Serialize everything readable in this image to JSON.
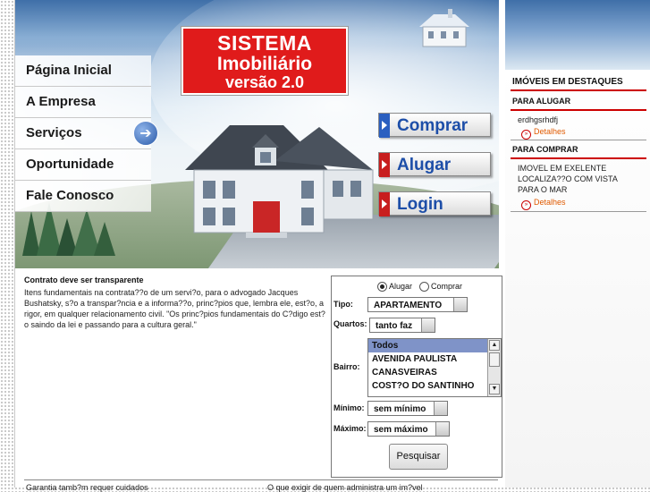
{
  "nav": {
    "items": [
      "Página Inicial",
      "A Empresa",
      "Serviços",
      "Oportunidade",
      "Fale Conosco"
    ]
  },
  "logo": {
    "line1": "SISTEMA",
    "line2": "Imobiliário",
    "line3": "versão 2.0"
  },
  "actions": {
    "comprar": "Comprar",
    "alugar": "Alugar",
    "login": "Login"
  },
  "sidebar": {
    "title": "IMÓVEIS EM DESTAQUES",
    "alugar_header": "PARA ALUGAR",
    "alugar_item": "erdhgsrhdfj",
    "detalhes1": "Detalhes",
    "comprar_header": "PARA COMPRAR",
    "comprar_item_l1": "IMOVEL EM EXELENTE",
    "comprar_item_l2": "LOCALIZA??O COM VISTA",
    "comprar_item_l3": "PARA O MAR",
    "detalhes2": "Detalhes"
  },
  "article": {
    "title": "Contrato deve ser transparente",
    "body": "Itens fundamentais na contrata??o de um servi?o, para o advogado Jacques Bushatsky, s?o a transpar?ncia e a informa??o, princ?pios que, lembra ele, est?o, a rigor, em qualquer relacionamento civil. \"Os princ?pios fundamentais do C?digo est?o saindo da lei e passando para a cultura geral.\""
  },
  "search": {
    "radio_alugar": "Alugar",
    "radio_comprar": "Comprar",
    "tipo_label": "Tipo:",
    "tipo_value": "APARTAMENTO",
    "quartos_label": "Quartos:",
    "quartos_value": "tanto faz",
    "bairro_label": "Bairro:",
    "bairro_options": [
      "Todos",
      "AVENIDA PAULISTA",
      "CANASVEIRAS",
      "COST?O DO SANTINHO"
    ],
    "minimo_label": "Mínimo:",
    "minimo_value": "sem mínimo",
    "maximo_label": "Máximo:",
    "maximo_value": "sem máximo",
    "button": "Pesquisar"
  },
  "footer": {
    "left": "Garantia tamb?m requer cuidados",
    "right": "O que exigir de quem administra um im?vel"
  },
  "colors": {
    "brand_red": "#e01b1b",
    "accent_blue": "#1d4ea8",
    "sidebar_rule": "#cc0000"
  }
}
